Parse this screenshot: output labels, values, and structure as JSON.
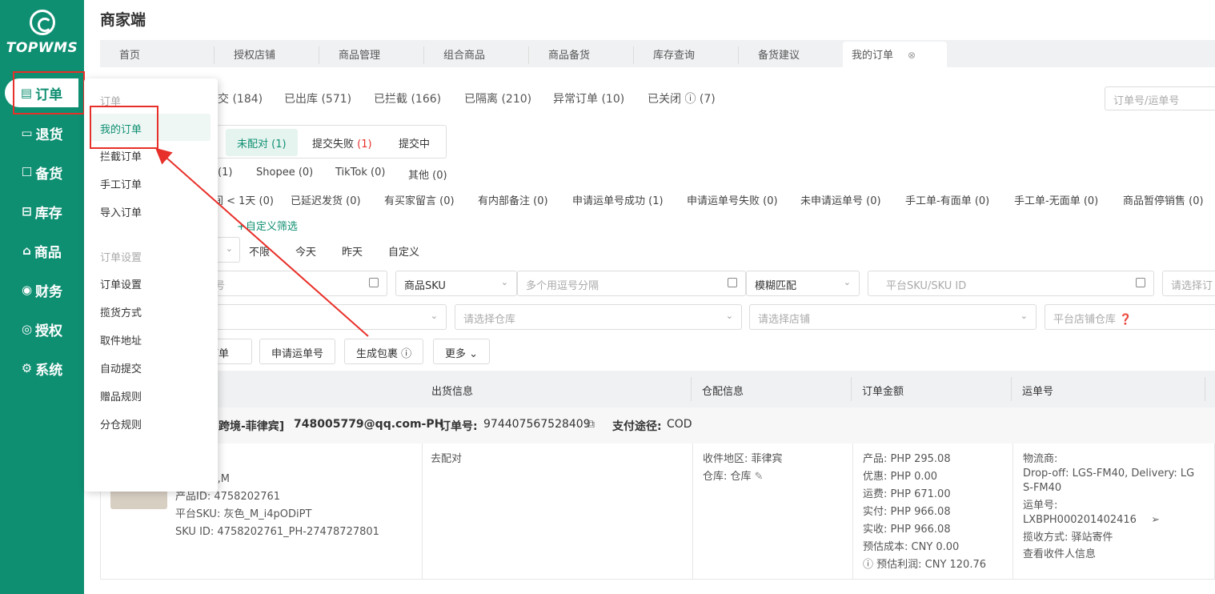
{
  "sidebar": {
    "logo_text": "TOPWMS",
    "items": [
      {
        "label": "订单",
        "icon": "document-icon",
        "active": true
      },
      {
        "label": "退货",
        "icon": "return-icon"
      },
      {
        "label": "备货",
        "icon": "stock-icon"
      },
      {
        "label": "库存",
        "icon": "warehouse-icon"
      },
      {
        "label": "商品",
        "icon": "bag-icon"
      },
      {
        "label": "财务",
        "icon": "finance-icon"
      },
      {
        "label": "授权",
        "icon": "auth-icon"
      },
      {
        "label": "系统",
        "icon": "gear-icon"
      }
    ]
  },
  "header": {
    "title": "商家端"
  },
  "tabs": [
    "首页",
    "授权店铺",
    "商品管理",
    "组合商品",
    "商品备货",
    "库存查询",
    "备货建议",
    "我的订单"
  ],
  "status_tabs": [
    "交 (184)",
    "已出库 (571)",
    "已拦截 (166)",
    "已隔离 (210)",
    "异常订单 (10)",
    "已关闭 ⓘ (7)"
  ],
  "search_placeholder": "订单号/运单号",
  "sub_tabs": {
    "unmatched": "未配对 (1)",
    "failed": "提交失败",
    "failed_count": "(1)",
    "submitting": "提交中"
  },
  "platforms": [
    "(1)",
    "Shopee (0)",
    "TikTok (0)",
    "其他 (0)"
  ],
  "flags": [
    "间 < 1天 (0)",
    "已延迟发货 (0)",
    "有买家留言 (0)",
    "有内部备注 (0)",
    "申请运单号成功 (1)",
    "申请运单号失败 (0)",
    "未申请运单号 (0)",
    "手工单-有面单 (0)",
    "手工单-无面单 (0)",
    "商品暂停销售 (0)"
  ],
  "custom_filter": "+自定义筛选",
  "dates": [
    "不限",
    "今天",
    "昨天",
    "自定义"
  ],
  "filters": {
    "f1": "号",
    "sku_select": "商品SKU",
    "multi_placeholder": "多个用逗号分隔",
    "match": "模糊匹配",
    "sku_placeholder": "平台SKU/SKU ID",
    "right_placeholder": "请选择订",
    "warehouse": "请选择仓库",
    "store": "请选择店铺",
    "platform_wh": "平台店铺仓库"
  },
  "buttons": [
    "订单",
    "申请运单号",
    "生成包裹 ⓘ",
    "更多 ⌄"
  ],
  "table": {
    "headers": [
      "出货信息",
      "仓配信息",
      "订单金额",
      "运单号"
    ],
    "order": {
      "store": "跨境-菲律宾]",
      "account": "748005779@qq.com-PH",
      "order_no_label": "订单号:",
      "order_no": "974407567528409",
      "pay_label": "支付途径:",
      "pay": "COD"
    },
    "product": {
      "attr": "格: Gray,M",
      "pid": "产品ID: 4758202761",
      "psku": "平台SKU: 灰色_M_i4pODiPT",
      "skuid": "SKU ID: 4758202761_PH-27478727801"
    },
    "ship_link": "去配对",
    "region": "收件地区: 菲律宾",
    "warehouse": "仓库: 仓库",
    "amounts": [
      "产品: PHP 295.08",
      "优惠: PHP 0.00",
      "运费: PHP 671.00",
      "实付: PHP 966.08",
      "实收: PHP 966.08",
      "预估成本: CNY 0.00",
      "ⓘ 预估利润: CNY 120.76"
    ],
    "carrier_label": "物流商:",
    "carrier_line1": "Drop-off: LGS-FM40, Delivery: LG",
    "carrier_line2": "S-FM40",
    "waybill_label": "运单号:",
    "waybill": "LXBPH000201402416",
    "pickup": "揽收方式: 驿站寄件",
    "view_receiver": "查看收件人信息"
  },
  "menu": {
    "group1": "订单",
    "items1": [
      "我的订单",
      "拦截订单",
      "手工订单",
      "导入订单"
    ],
    "group2": "订单设置",
    "items2": [
      "订单设置",
      "揽货方式",
      "取件地址",
      "自动提交",
      "赠品规则",
      "分仓规则"
    ]
  },
  "colors": {
    "brand": "#0f8f72",
    "annotation": "#e8302a"
  }
}
